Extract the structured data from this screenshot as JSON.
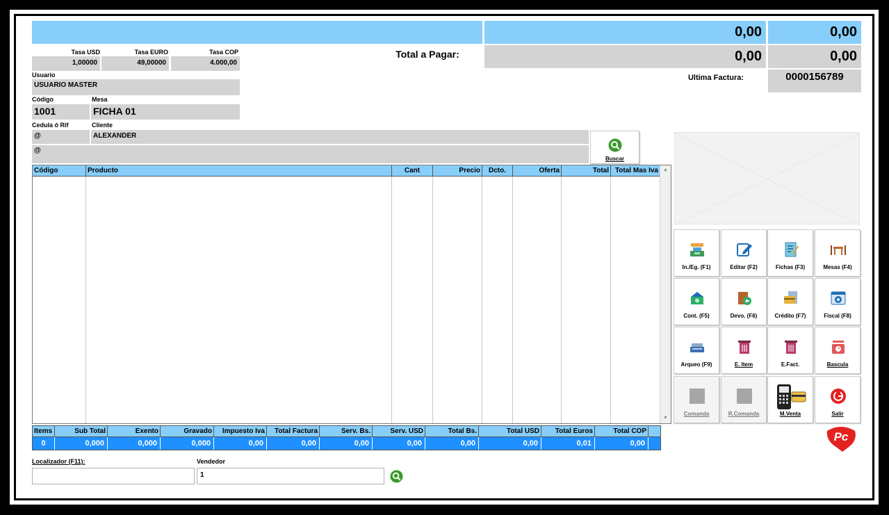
{
  "totals_top": {
    "usd_top": "0,00",
    "bs_top": "0,00",
    "total_label": "Total a Pagar:",
    "usd_total": "0,00",
    "bs_total": "0,00",
    "last_invoice_label": "Ultima Factura:",
    "last_invoice_value": "0000156789"
  },
  "rates": [
    {
      "label": "Tasa USD",
      "value": "1,00000"
    },
    {
      "label": "Tasa EURO",
      "value": "49,00000"
    },
    {
      "label": "Tasa COP",
      "value": "4.000,00"
    }
  ],
  "user": {
    "label": "Usuario",
    "value": "USUARIO MASTER"
  },
  "code": {
    "label": "Código",
    "value": "1001"
  },
  "table": {
    "label": "Mesa",
    "value": "FICHA 01"
  },
  "client": {
    "id_label": "Cedula ó Rif",
    "name_label": "Cliente",
    "id_value": "@",
    "name_value": "ALEXANDER",
    "address_value": "@",
    "search_label": "Buscar"
  },
  "grid": {
    "columns": [
      "Código",
      "Producto",
      "Cant",
      "Precio",
      "Dcto.",
      "Oferta",
      "Total",
      "Total Mas Iva"
    ]
  },
  "summary": {
    "headers": [
      "Items",
      "Sub Total",
      "Exento",
      "Gravado",
      "Impuesto Iva",
      "Total Factura",
      "Serv. Bs.",
      "Serv. USD",
      "Total Bs.",
      "Total USD",
      "Total Euros",
      "Total COP"
    ],
    "values": [
      "0",
      "0,000",
      "0,000",
      "0,000",
      "0,00",
      "0,00",
      "0,00",
      "0,00",
      "0,00",
      "0,00",
      "0,01",
      "0,00"
    ]
  },
  "bottom": {
    "locator_label": "Localizador (F11):",
    "locator_value": "",
    "seller_label": "Vendedor",
    "seller_value": "1"
  },
  "buttons": [
    {
      "label": "In./Eg. (F1)",
      "icon": "cash-register-icon"
    },
    {
      "label": "Editar (F2)",
      "icon": "edit-icon"
    },
    {
      "label": "Fichas (F3)",
      "icon": "clipboard-icon"
    },
    {
      "label": "Mesas (F4)",
      "icon": "table-chairs-icon"
    },
    {
      "label": "Cont. (F5)",
      "icon": "money-icon"
    },
    {
      "label": "Devo. (F6)",
      "icon": "return-icon"
    },
    {
      "label": "Crédito (F7)",
      "icon": "credit-card-icon"
    },
    {
      "label": "Fiscal (F8)",
      "icon": "fiscal-gear-icon"
    },
    {
      "label": "Arqueo (F9)",
      "icon": "register-count-icon"
    },
    {
      "label": "E. Item",
      "icon": "trash-item-icon"
    },
    {
      "label": "E.Fact.",
      "icon": "trash-invoice-icon"
    },
    {
      "label": "Bascula",
      "icon": "scale-icon"
    },
    {
      "label": "Comanda",
      "icon": "placeholder-icon"
    },
    {
      "label": "R.Comanda",
      "icon": "placeholder-icon"
    },
    {
      "label": "M.Venta",
      "icon": "pos-terminal-icon"
    },
    {
      "label": "Salir",
      "icon": "exit-icon"
    }
  ],
  "logo_text": "Pc",
  "colors": {
    "header_blue": "#87cefa",
    "totals_blue": "#1e90ff",
    "field_gray": "#d3d3d3",
    "exit_red": "#e52222"
  }
}
